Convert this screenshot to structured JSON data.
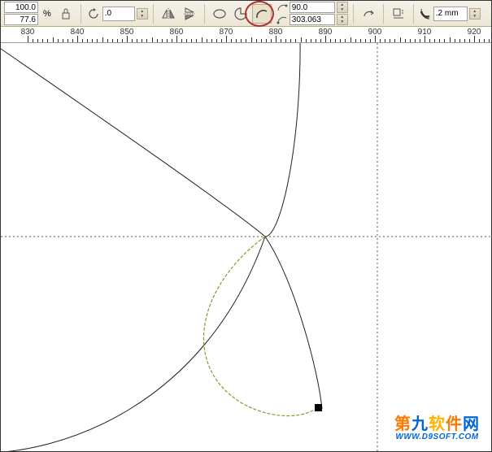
{
  "toolbar": {
    "scaleX": "100.0",
    "scaleY": "77.6",
    "percent": "%",
    "rotation": ".0",
    "arcStart": "90.0",
    "arcEnd": "303.063",
    "outlineWidth": ".2 mm"
  },
  "icons": {
    "lock": "lock-icon",
    "rotate": "rotate-icon",
    "mirrorH": "mirror-horizontal-icon",
    "mirrorV": "mirror-vertical-icon",
    "ellipse": "ellipse-icon",
    "pie": "pie-icon",
    "arc": "arc-icon",
    "arcStart": "arc-start-icon",
    "arcEnd": "arc-end-icon",
    "swapArc": "swap-arc-icon",
    "wrap": "wrap-text-icon",
    "outline": "outline-width-icon"
  },
  "ruler": {
    "majorTicks": [
      830,
      840,
      850,
      860,
      870,
      880,
      890,
      900,
      910,
      920
    ],
    "pxPerUnit": 6.1,
    "origin": 830,
    "offsetPx": 33
  },
  "guides": {
    "vGuideX": 463,
    "hGuideY": 238
  },
  "watermark": {
    "text": "第九软件网",
    "sub": "WWW.D9SOFT.COM"
  },
  "colors": {
    "toolbarTop": "#f5f2e8",
    "toolbarBottom": "#ece6d4",
    "annotation": "#b03030",
    "guide": "#555555"
  }
}
